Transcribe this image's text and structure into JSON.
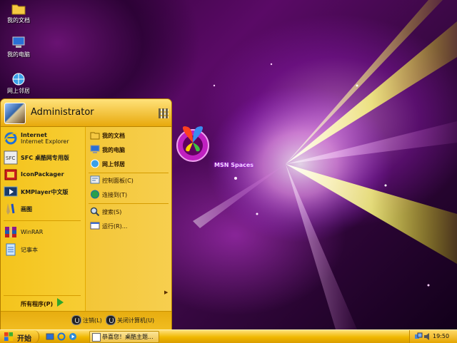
{
  "desktop": {
    "icons": [
      {
        "label": "我的文档",
        "icon": "folder-icon"
      },
      {
        "label": "我的电脑",
        "icon": "computer-icon"
      },
      {
        "label": "网上邻居",
        "icon": "network-icon"
      }
    ],
    "msn_label": "MSN Spaces"
  },
  "start_menu": {
    "user": "Administrator",
    "left_items": [
      {
        "title": "Internet",
        "subtitle": "Internet Explorer",
        "icon": "internet-explorer-icon"
      },
      {
        "title": "SFC 桌酷网专用版",
        "icon": "sfc-icon"
      },
      {
        "title": "IconPackager",
        "icon": "iconpackager-icon"
      },
      {
        "title": "KMPlayer中文版",
        "icon": "kmplayer-icon"
      },
      {
        "title": "画图",
        "icon": "paint-icon"
      },
      {
        "title": "WinRAR",
        "icon": "winrar-icon"
      },
      {
        "title": "记事本",
        "icon": "notepad-icon"
      }
    ],
    "all_programs": "所有程序(P)",
    "right_items": [
      {
        "label": "我的文档",
        "icon": "my-documents-icon"
      },
      {
        "label": "我的电脑",
        "icon": "my-computer-icon"
      },
      {
        "label": "网上邻居",
        "icon": "my-network-icon"
      },
      {
        "label": "控制面板(C)",
        "icon": "control-panel-icon"
      },
      {
        "label": "连接到(T)",
        "icon": "connect-to-icon"
      },
      {
        "label": "搜索(S)",
        "icon": "search-icon"
      },
      {
        "label": "运行(R)...",
        "icon": "run-icon"
      }
    ],
    "logoff_label": "注销(L)",
    "shutdown_label": "关闭计算机(U)"
  },
  "taskbar": {
    "start_label": "开始",
    "task_label": "恭喜您！桌酷主题...",
    "clock": "19:50"
  }
}
